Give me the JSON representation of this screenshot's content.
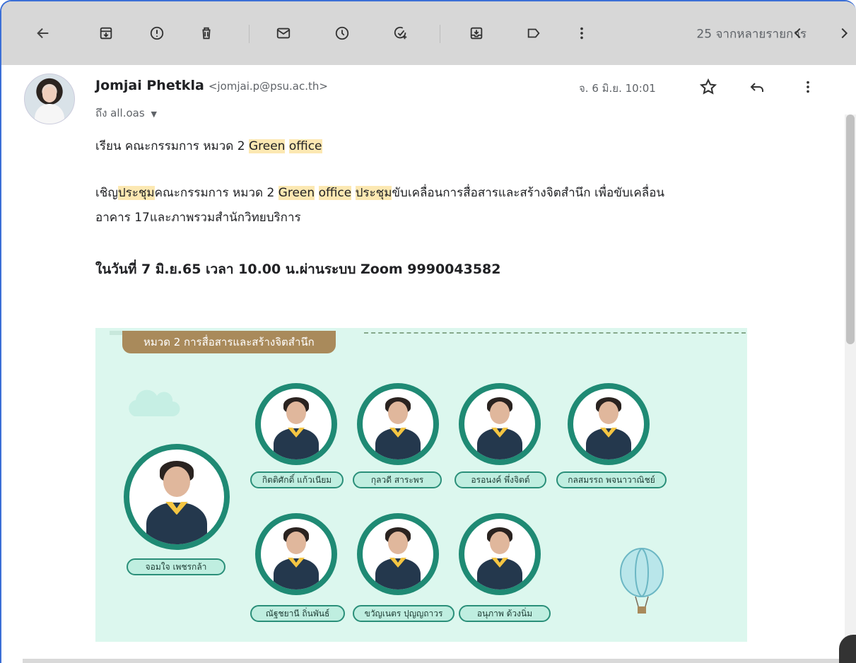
{
  "toolbar": {
    "count_label": "25 จากหลายรายการ",
    "icons": [
      "back-arrow-icon",
      "archive-icon",
      "report-spam-icon",
      "delete-icon",
      "mark-unread-icon",
      "snooze-icon",
      "add-task-icon",
      "move-to-icon",
      "label-icon",
      "more-vert-icon",
      "prev-icon",
      "next-icon"
    ]
  },
  "message": {
    "sender_name": "Jomjai Phetkla",
    "sender_email": "<jomjai.p@psu.ac.th>",
    "to_label": "ถึง all.oas",
    "date": "จ. 6 มิ.ย. 10:01",
    "body": {
      "line1_prefix": "เรียน คณะกรรมการ หมวด 2 ",
      "line1_hl1": "Green",
      "line1_hl2": "office",
      "line2_pre": "เชิญ",
      "line2_hl1": "ประชุม",
      "line2_mid": "คณะกรรมการ หมวด 2 ",
      "line2_hl2": "Green",
      "line2_hl3": "office",
      "line2_hl4": "ประชุม",
      "line2_post": "ขับเคลื่อนการสื่อสารและสร้างจิตสำนึก เพื่อขับเคลื่อน",
      "line3": "อาคาร 17และภาพรวมสำนักวิทยบริการ",
      "line4": "ในวันที่ 7 มิ.ย.65 เวลา 10.00 น.ผ่านระบบ Zoom 9990043582"
    }
  },
  "poster": {
    "title": "หมวด 2 การสื่อสารและสร้างจิตสำนึก",
    "leader": "จอมใจ เพชรกล้า",
    "members": [
      "กิตติศักดิ์ แก้วเนียม",
      "กุลวดี สาระพร",
      "อรอนงค์ พึ่งจิตต์",
      "กลสมรรถ พจนาวาณิชย์",
      "ณัฐชยานี ถิ่นพันธ์",
      "ขวัญเนตร ปุญญถาวร",
      "อนุภาพ ด้วงนิ่ม"
    ],
    "colors": {
      "background": "#dcf7ee",
      "ring": "#1f8a74",
      "pill": "#a98a5b"
    }
  },
  "colors": {
    "toolbar": "#d7d7d7",
    "highlight": "#fce8b2"
  }
}
